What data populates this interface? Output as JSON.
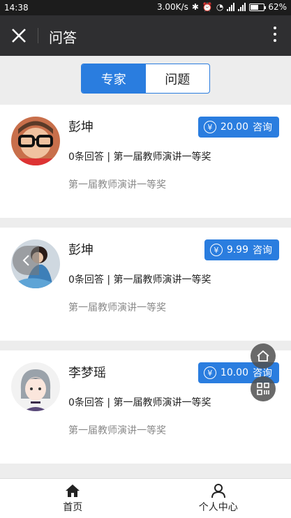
{
  "status_bar": {
    "time": "14:38",
    "speed": "3.00K/s",
    "battery": "62%",
    "battery_level": 0.62
  },
  "header": {
    "title": "问答"
  },
  "segment": {
    "tabs": [
      {
        "label": "专家",
        "active": true
      },
      {
        "label": "问题",
        "active": false
      }
    ]
  },
  "experts": [
    {
      "name": "彭坤",
      "price": "20.00",
      "consult": "咨询",
      "meta": "0条回答 | 第一届教师演讲一等奖",
      "desc": "第一届教师演讲一等奖"
    },
    {
      "name": "彭坤",
      "price": "9.99",
      "consult": "咨询",
      "meta": "0条回答 | 第一届教师演讲一等奖",
      "desc": "第一届教师演讲一等奖"
    },
    {
      "name": "李梦瑶",
      "price": "10.00",
      "consult": "咨询",
      "meta": "0条回答 | 第一届教师演讲一等奖",
      "desc": "第一届教师演讲一等奖"
    }
  ],
  "tab_bar": {
    "items": [
      {
        "label": "首页",
        "icon": "home-icon"
      },
      {
        "label": "个人中心",
        "icon": "user-icon"
      }
    ]
  },
  "colors": {
    "accent": "#2a7ddf",
    "header_bg": "#2f2f31"
  }
}
